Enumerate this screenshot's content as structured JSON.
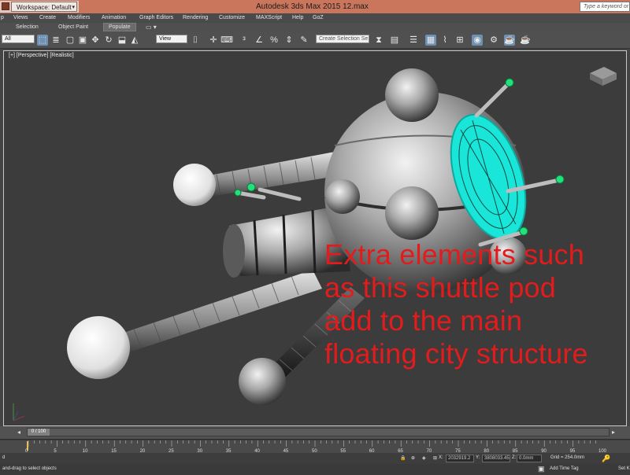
{
  "app": {
    "title": "Autodesk 3ds Max  2015        12.max",
    "workspace_label": "Workspace: Default",
    "search_placeholder": "Type a keyword or phrase"
  },
  "menu": [
    "p",
    "Views",
    "Create",
    "Modifiers",
    "Animation",
    "Graph Editors",
    "Rendering",
    "Customize",
    "MAXScript",
    "Help",
    "GoZ"
  ],
  "ribbon": {
    "tabs": [
      "Selection",
      "Object Paint"
    ],
    "populate_label": "Populate"
  },
  "toolbar": {
    "filter_value": "All",
    "view_value": "View",
    "selection_set_placeholder": "Create Selection Se"
  },
  "viewport": {
    "label": "[+] [Perspective] [Realistic]"
  },
  "overlay_text": {
    "lines": [
      "Extra elements such",
      "as this shuttle pod",
      "add to the main",
      "floating city structure"
    ]
  },
  "timeline": {
    "frame_readout": "0 / 100",
    "ticks": [
      "0",
      "5",
      "10",
      "15",
      "20",
      "25",
      "30",
      "35",
      "40",
      "45",
      "50",
      "55",
      "60",
      "65",
      "70",
      "75",
      "80",
      "85",
      "90",
      "95",
      "100"
    ]
  },
  "status": {
    "left_indicator": "d",
    "x_label": "X:",
    "x_value": "2032919.2",
    "y_label": "Y:",
    "y_value": "3808033.45",
    "z_label": "Z:",
    "z_value": "0.0mm",
    "grid_label": "Grid = 254.0mm",
    "prompt": "and-drag to select objects",
    "add_time_tag": "Add Time Tag",
    "set_key": "Set K"
  },
  "colors": {
    "title_bar": "#c9765d",
    "overlay_text": "#e21c1c",
    "selection_highlight": "#19e6d8",
    "active_tool": "#6f8fb3"
  }
}
